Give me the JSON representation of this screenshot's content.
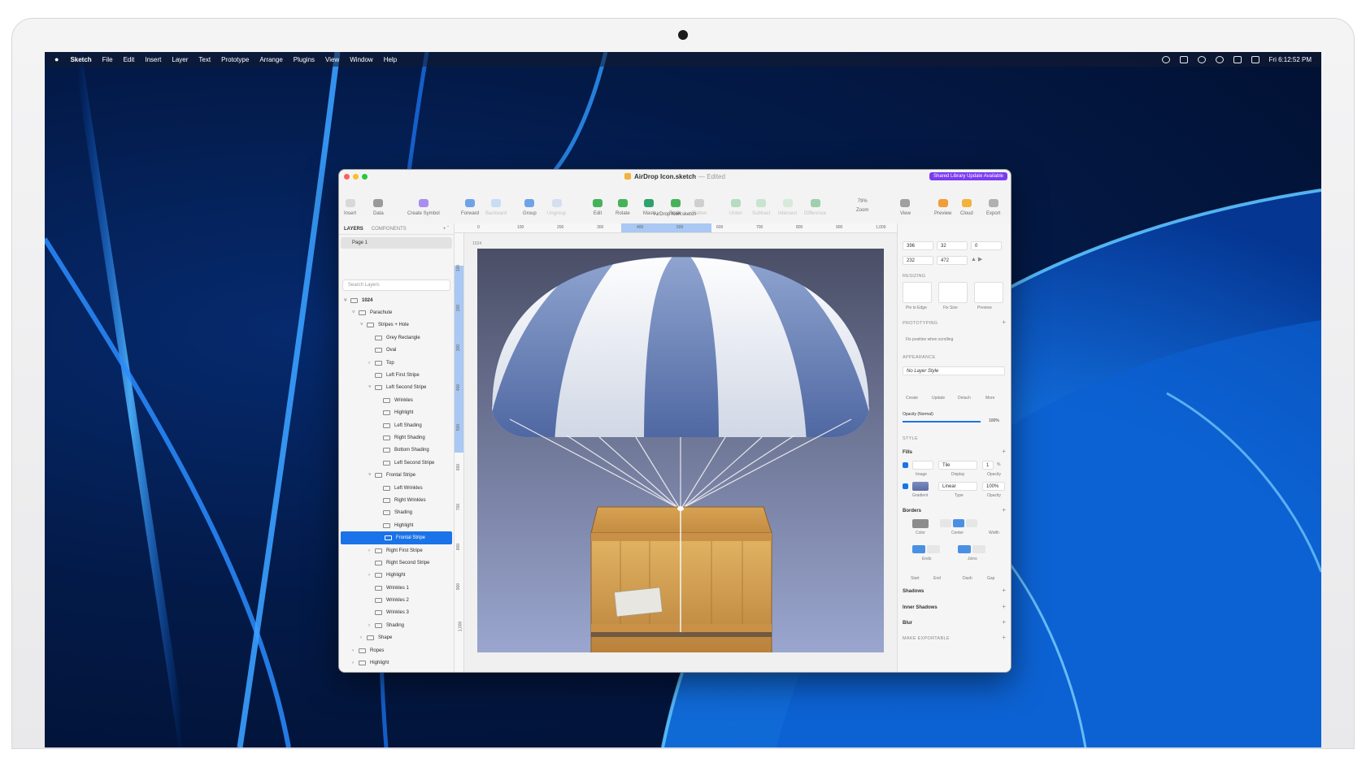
{
  "menubar": {
    "app": "Sketch",
    "items": [
      "File",
      "Edit",
      "Insert",
      "Layer",
      "Text",
      "Prototype",
      "Arrange",
      "Plugins",
      "View",
      "Window",
      "Help"
    ],
    "clock": "Fri 6:12:52 PM"
  },
  "window": {
    "title": "AirDrop Icon.sketch",
    "edited": "— Edited",
    "badge": "Shared Library Update Available",
    "subtitle": "AirDrop Icon.sketch"
  },
  "toolbar": {
    "insert": "Insert",
    "data": "Data",
    "create_symbol": "Create Symbol",
    "forward": "Forward",
    "backward": "Backward",
    "group": "Group",
    "ungroup": "Ungroup",
    "edit": "Edit",
    "rotate": "Rotate",
    "mask": "Mask",
    "scale": "Scale",
    "flatten": "Flatten",
    "union": "Union",
    "subtract": "Subtract",
    "intersect": "Intersect",
    "difference": "Difference",
    "zoom": "Zoom",
    "zoom_value": "79%",
    "view": "View",
    "preview": "Preview",
    "cloud": "Cloud",
    "export": "Export"
  },
  "sidebar": {
    "tab_layers": "LAYERS",
    "tab_components": "COMPONENTS",
    "page": "Page 1",
    "search_placeholder": "Search Layers",
    "layers": [
      {
        "name": "1024",
        "indent": 0,
        "bold": true,
        "chev": "v"
      },
      {
        "name": "Parachute",
        "indent": 1,
        "chev": "v"
      },
      {
        "name": "Stripes + Hole",
        "indent": 2,
        "chev": "v"
      },
      {
        "name": "Grey Rectangle",
        "indent": 3,
        "chev": ""
      },
      {
        "name": "Oval",
        "indent": 3,
        "chev": ""
      },
      {
        "name": "Top",
        "indent": 3,
        "chev": ">"
      },
      {
        "name": "Left First Stripe",
        "indent": 3,
        "chev": ""
      },
      {
        "name": "Left Second Stripe",
        "indent": 3,
        "chev": "v"
      },
      {
        "name": "Wrinkles",
        "indent": 4,
        "chev": ""
      },
      {
        "name": "Highlight",
        "indent": 4,
        "chev": ""
      },
      {
        "name": "Left Shading",
        "indent": 4,
        "chev": ""
      },
      {
        "name": "Right Shading",
        "indent": 4,
        "chev": ""
      },
      {
        "name": "Bottom Shading",
        "indent": 4,
        "chev": ""
      },
      {
        "name": "Left Second Stripe",
        "indent": 4,
        "chev": ""
      },
      {
        "name": "Frontal Stripe",
        "indent": 3,
        "chev": "v"
      },
      {
        "name": "Left Wrinkles",
        "indent": 4,
        "chev": ""
      },
      {
        "name": "Right Wrinkles",
        "indent": 4,
        "chev": ""
      },
      {
        "name": "Shading",
        "indent": 4,
        "chev": ""
      },
      {
        "name": "Highlight",
        "indent": 4,
        "chev": ""
      },
      {
        "name": "Frontal Stripe",
        "indent": 4,
        "chev": "",
        "selected": true
      },
      {
        "name": "Right First Stripe",
        "indent": 3,
        "chev": ">"
      },
      {
        "name": "Right Second Stripe",
        "indent": 3,
        "chev": ""
      },
      {
        "name": "Highlight",
        "indent": 3,
        "chev": ">"
      },
      {
        "name": "Wrinkles 1",
        "indent": 3,
        "chev": ""
      },
      {
        "name": "Wrinkles 2",
        "indent": 3,
        "chev": ""
      },
      {
        "name": "Wrinkles 3",
        "indent": 3,
        "chev": ""
      },
      {
        "name": "Shading",
        "indent": 3,
        "chev": ">"
      },
      {
        "name": "Shape",
        "indent": 2,
        "chev": ">"
      },
      {
        "name": "Ropes",
        "indent": 1,
        "chev": ">"
      },
      {
        "name": "Highlight",
        "indent": 1,
        "chev": ">"
      }
    ]
  },
  "canvas": {
    "frame_label": "1024",
    "top_ticks": [
      "0",
      "100",
      "200",
      "300",
      "400",
      "500",
      "600",
      "700",
      "800",
      "900",
      "1,000"
    ],
    "left_ticks": [
      "100",
      "200",
      "300",
      "400",
      "500",
      "600",
      "700",
      "800",
      "900",
      "1,000"
    ]
  },
  "inspector": {
    "x": "396",
    "y": "32",
    "rot": "0",
    "w": "232",
    "h": "472",
    "resizing": "RESIZING",
    "pin_to_edge": "Pin to Edge",
    "fix_size": "Fix Size",
    "preview": "Preview",
    "prototyping": "PROTOTYPING",
    "fix_position": "Fix position when scrolling",
    "appearance": "APPEARANCE",
    "layer_style": "No Layer Style",
    "create": "Create",
    "update": "Update",
    "detach": "Detach",
    "more": "More",
    "opacity_label": "Opacity (Normal)",
    "opacity_value": "100%",
    "opacity_level": 1.0,
    "style": "STYLE",
    "fills": "Fills",
    "fill1_display": "Tile",
    "fill1_num": "1",
    "fill1_pct": "%",
    "image": "Image",
    "display": "Display",
    "opacity": "Opacity",
    "fill2_type": "Linear",
    "fill2_opacity": "100%",
    "gradient": "Gradient",
    "type": "Type",
    "borders": "Borders",
    "color": "Color",
    "center": "Center",
    "width": "Width",
    "ends": "Ends",
    "joins": "Joins",
    "start": "Start",
    "end": "End",
    "dash": "Dash",
    "gap": "Gap",
    "shadows": "Shadows",
    "inner_shadows": "Inner Shadows",
    "blur": "Blur",
    "make_exportable": "MAKE EXPORTABLE"
  }
}
